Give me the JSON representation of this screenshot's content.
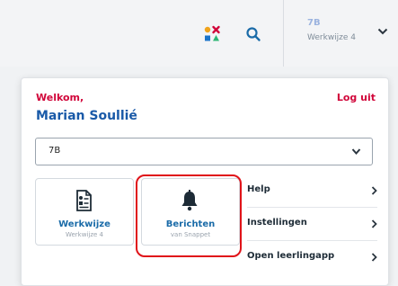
{
  "header": {
    "class_code": "7B",
    "class_method": "Werkwijze 4"
  },
  "panel": {
    "welcome": "Welkom,",
    "logout": "Log uit",
    "username": "Marian Soullié",
    "group_select": {
      "value": "7B"
    },
    "tiles": [
      {
        "title": "Werkwijze",
        "subtitle": "Werkwijze 4",
        "icon": "document-icon"
      },
      {
        "title": "Berichten",
        "subtitle": "van Snappet",
        "icon": "bell-icon"
      }
    ],
    "menu": [
      {
        "label": "Help"
      },
      {
        "label": "Instellingen"
      },
      {
        "label": "Open leerlingapp"
      }
    ]
  },
  "colors": {
    "accent_red": "#d1063a",
    "accent_blue": "#1a5aa8",
    "highlight_red": "#e01319"
  }
}
